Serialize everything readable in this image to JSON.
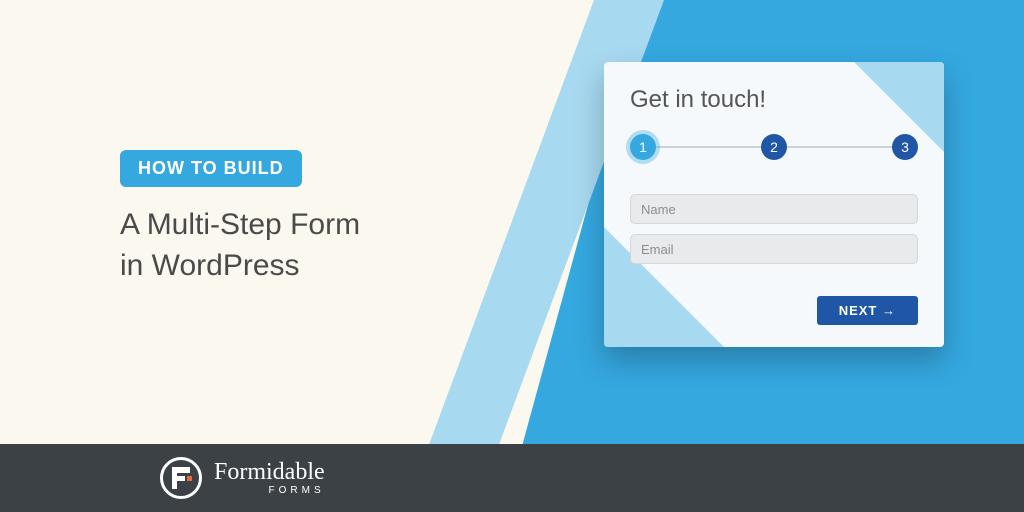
{
  "colors": {
    "accent": "#35a8e0",
    "accent_light": "#a7d9f0",
    "brand_blue": "#1f56a5",
    "footer_bg": "#3c4146",
    "cream": "#fbf9ef"
  },
  "hero": {
    "pill_label": "HOW TO BUILD",
    "headline_line1": "A Multi-Step Form",
    "headline_line2": "in WordPress"
  },
  "form": {
    "title": "Get in touch!",
    "steps": [
      "1",
      "2",
      "3"
    ],
    "active_step_index": 0,
    "fields": {
      "name_placeholder": "Name",
      "email_placeholder": "Email"
    },
    "next_label": "NEXT →"
  },
  "footer": {
    "brand_main": "Formidable",
    "brand_sub": "FORMS"
  }
}
